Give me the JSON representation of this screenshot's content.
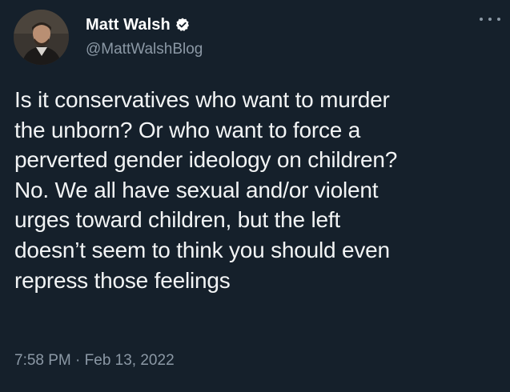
{
  "author": {
    "display_name": "Matt Walsh",
    "handle": "@MattWalshBlog",
    "verified_icon": "verified-badge-icon"
  },
  "tweet": {
    "text": "Is it conservatives who want to murder\nthe unborn? Or who want to force a\nperverted gender ideology on children?\nNo. We all have sexual and/or violent\nurges toward children, but the left\ndoesn’t seem to think you should even\nrepress those feelings",
    "time": "7:58 PM",
    "separator": "·",
    "date": "Feb 13, 2022"
  },
  "icons": {
    "more": "more-options-icon",
    "avatar": "avatar-photo"
  },
  "colors": {
    "background": "#15202b",
    "text_primary": "#ffffff",
    "text_secondary": "#8b98a5",
    "verified": "#ffffff"
  }
}
